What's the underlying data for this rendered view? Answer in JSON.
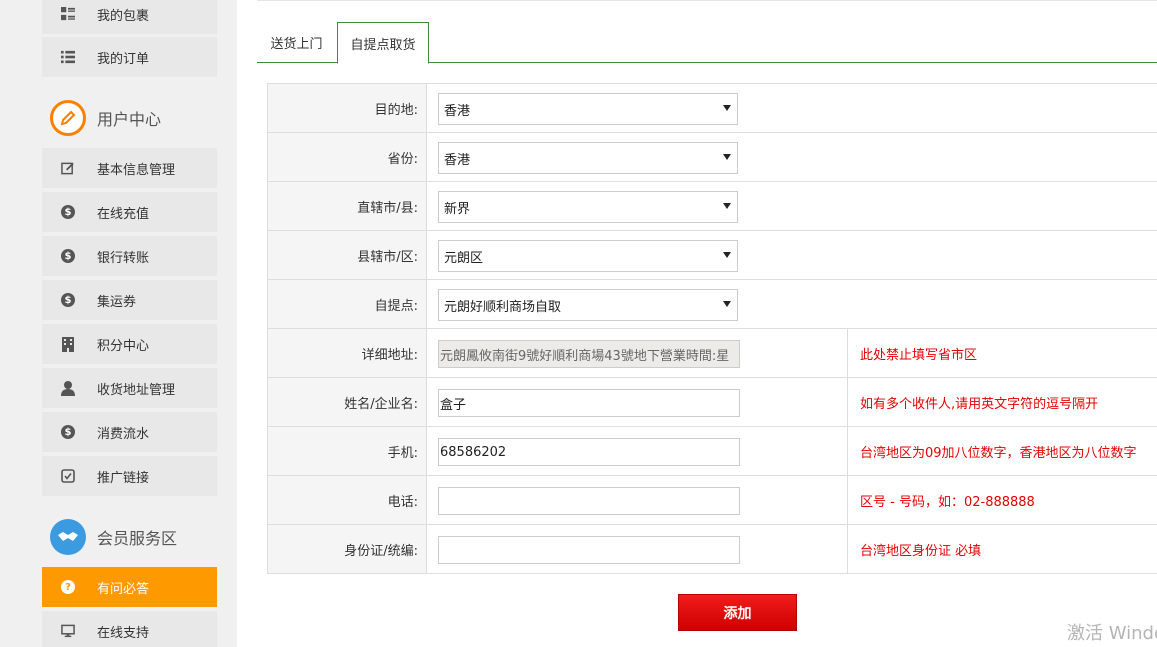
{
  "sidebar": {
    "items_top": [
      {
        "label": "我的包裹",
        "icon": "grid-list-icon"
      },
      {
        "label": "我的订单",
        "icon": "list-icon"
      }
    ],
    "section_user": {
      "title": "用户中心",
      "icon": "pencil-icon",
      "color": "#ff7f00"
    },
    "items_user": [
      {
        "label": "基本信息管理",
        "icon": "edit-icon"
      },
      {
        "label": "在线充值",
        "icon": "dollar-icon"
      },
      {
        "label": "银行转账",
        "icon": "dollar-icon"
      },
      {
        "label": "集运券",
        "icon": "dollar-icon"
      },
      {
        "label": "积分中心",
        "icon": "building-icon"
      },
      {
        "label": "收货地址管理",
        "icon": "user-icon"
      },
      {
        "label": "消费流水",
        "icon": "dollar-icon"
      },
      {
        "label": "推广链接",
        "icon": "checkbox-icon"
      }
    ],
    "section_member": {
      "title": "会员服务区",
      "icon": "handshake-icon",
      "color": "#3b9be0"
    },
    "items_member": [
      {
        "label": "有问必答",
        "icon": "question-icon",
        "active": true
      },
      {
        "label": "在线支持",
        "icon": "monitor-icon"
      }
    ]
  },
  "tabs": [
    {
      "label": "送货上门",
      "active": false
    },
    {
      "label": "自提点取货",
      "active": true
    }
  ],
  "form": {
    "destination": {
      "label": "目的地:",
      "value": "香港"
    },
    "province": {
      "label": "省份:",
      "value": "香港"
    },
    "city": {
      "label": "直辖市/县:",
      "value": "新界"
    },
    "district": {
      "label": "县辖市/区:",
      "value": "元朗区"
    },
    "pickup": {
      "label": "自提点:",
      "value": "元朗好顺利商场自取"
    },
    "address": {
      "label": "详细地址:",
      "value": "元朗鳳攸南街9號好順利商場43號地下營業時間:星",
      "hint": "此处禁止填写省市区"
    },
    "name": {
      "label": "姓名/企业名:",
      "value": "盒子",
      "hint": "如有多个收件人,请用英文字符的逗号隔开"
    },
    "mobile": {
      "label": "手机:",
      "value": "68586202",
      "hint": "台湾地区为09加八位数字，香港地区为八位数字"
    },
    "phone": {
      "label": "电话:",
      "value": "",
      "hint": "区号 - 号码，如：02-888888"
    },
    "idcard": {
      "label": "身份证/统编:",
      "value": "",
      "hint": "台湾地区身份证 必填"
    }
  },
  "submit_label": "添加",
  "watermark": "激活 Windows",
  "colors": {
    "accent": "#ff9900",
    "tab_border": "#3c8c3c",
    "hint": "#e60000",
    "button": "#e00000"
  }
}
